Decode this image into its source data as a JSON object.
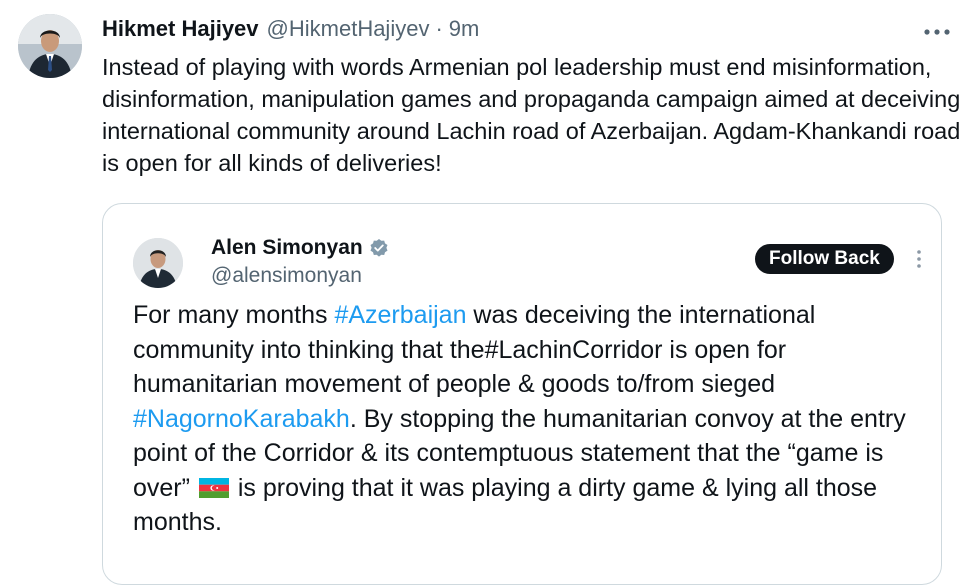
{
  "author": {
    "name": "Hikmet Hajiyev",
    "handle": "@HikmetHajiyev",
    "separator": "·",
    "time": "9m",
    "avatar_icon": "person-suit-avatar"
  },
  "more_icon": "more-horizontal-icon",
  "tweet_text": "Instead of playing with words Armenian pol leadership must end misinformation, disinformation, manipulation games and propaganda campaign aimed at deceiving international community around Lachin road of Azerbaijan. Agdam-Khankandi road is open for all kinds of deliveries!",
  "quote": {
    "name": "Alen Simonyan",
    "handle": "@alensimonyan",
    "verified_icon": "verified-badge-icon",
    "follow_label": "Follow Back",
    "more_icon": "more-vertical-icon",
    "text": {
      "p1": "For many months ",
      "tag1": "#Azerbaijan",
      "p2": " was deceiving the international community into thinking that the",
      "tag2": "#LachinCorridor",
      "p3": " is open for humanitarian movement of people & goods to/from sieged ",
      "tag3": "#NagornoKarabakh",
      "p4": ". By stopping the humanitarian convoy at the entry point of the Corridor & its contemptuous statement that the “game is over” ",
      "flag_icon": "azerbaijan-flag-icon",
      "p5": " is proving that it was playing a dirty game & lying all those months."
    }
  },
  "colors": {
    "text": "#0f1419",
    "secondary": "#536471",
    "link": "#1d9bf0",
    "border": "#cfd9de",
    "button_bg": "#0f1419"
  }
}
